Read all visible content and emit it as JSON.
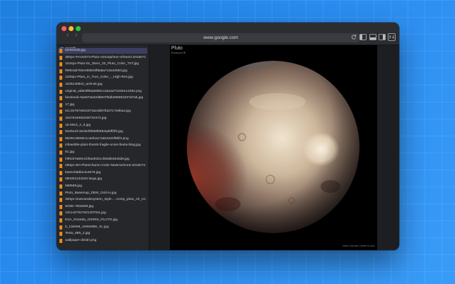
{
  "browser": {
    "address": "www.google.com",
    "back_glyph": "‹",
    "forward_glyph": "›"
  },
  "sidebar": {
    "search_label": "search",
    "selected_index": 0,
    "files": [
      "82WUkZk.jpg",
      "300px-PIA20373-Pluto-Atmosphere-Infrared-20160714.jpg",
      "1024px-Pluto-01_Stern_03_Pluto_Color_TXT.jpg",
      "f9094ab782e495819f8a8a713a42653.jpg",
      "1200px-Pluto_in_True_Color_-_High-Res.jpg",
      "1625130810_animok.jpg",
      "original_ad8c9f96a5992cc2aea271e94e14284.png",
      "facebook-0a267a542d5507f6db298052237d7ab.jpg",
      "17.jpg",
      "51c157579d43373a18d87b32717e8ba4.jpg",
      "1527944083166732472.jpg",
      "15-5810_2_6.jpg",
      "92ebe1fc15cbef9b68f5993ad0ff3f3.jpg",
      "9529cc8848c1c4efea17a615420f8bf4.png",
      "infeasible-pluto-thumb-fragile-onion-fiesta-blog.jpg",
      "81.jpg",
      "f4f0c87a69c41f0a291bccb56d64645d9.jpg",
      "290px-NH-PlutoCharon-Color-NewHorizons-20150711.jpg",
      "ba61cb8dbe4e4679.jpg",
      "090302133220-large.jpg",
      "598589.jpg",
      "Pluto_Basemap_DEM_Grid-ru.jpg",
      "300px-Outerandenystem_style-...-comp_pluto_nh_crop-rv.png",
      "WISE-750x600.jpg",
      "1311427917621207911.jpg",
      "ESA_Rosetta_OSIRIS_PLUTO.jpg",
      "0_13e0e8_4260e89e_XL.jpg",
      "Testo_885_2.jpg",
      "wallpaper-dimitri.png"
    ]
  },
  "viewer": {
    "title": "Pluto",
    "subtitle": "Enhanced IR",
    "credit": "NASA | JHU-APL | SwRI | Di Guim"
  },
  "colors": {
    "accent_selection": "#3b3f60",
    "file_icon": "#e68a1e",
    "search_icon": "#4a8cff"
  }
}
